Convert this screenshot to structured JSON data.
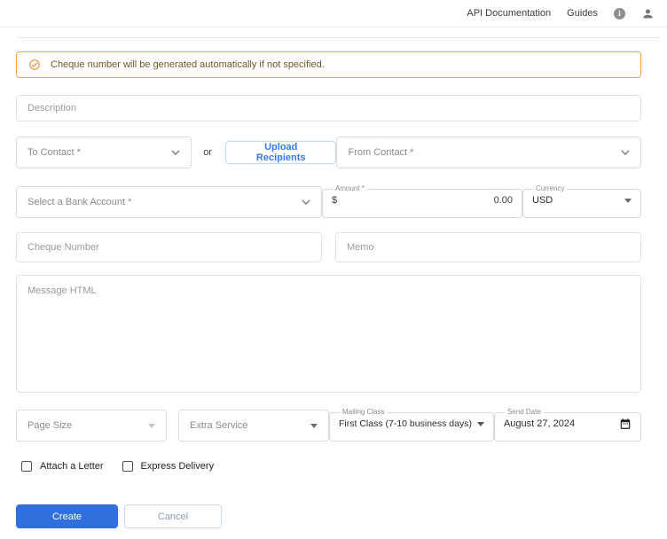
{
  "header": {
    "links": [
      {
        "label": "API Documentation"
      },
      {
        "label": "Guides"
      }
    ],
    "info_icon": "info-icon",
    "user_icon": "user-icon"
  },
  "banner": {
    "icon": "check-circle-icon",
    "text": "Cheque number will be generated automatically if not specified."
  },
  "form": {
    "description": {
      "placeholder": "Description"
    },
    "to_contact": {
      "label": "To Contact *"
    },
    "or_label": "or",
    "upload_recipients_label": "Upload Recipients",
    "from_contact": {
      "label": "From Contact *"
    },
    "bank_account": {
      "label": "Select a Bank Account *"
    },
    "amount": {
      "label": "Amount *",
      "prefix": "$",
      "value": "0.00"
    },
    "currency": {
      "label": "Currency",
      "value": "USD"
    },
    "cheque_number": {
      "placeholder": "Cheque Number"
    },
    "memo": {
      "placeholder": "Memo"
    },
    "message_html": {
      "placeholder": "Message HTML"
    },
    "page_size": {
      "label": "Page Size"
    },
    "extra_service": {
      "label": "Extra Service"
    },
    "mailing_class": {
      "label": "Mailing Class",
      "value": "First Class (7-10 business days)"
    },
    "send_date": {
      "label": "Send Date",
      "value": "August 27, 2024",
      "icon": "calendar-icon"
    },
    "checkboxes": [
      {
        "label": "Attach a Letter",
        "checked": false
      },
      {
        "label": "Express Delivery",
        "checked": false
      }
    ],
    "create_label": "Create",
    "cancel_label": "Cancel"
  },
  "colors": {
    "accent_blue": "#2f6fde",
    "link_blue": "#3b79e8",
    "banner_orange": "#f0a44c",
    "banner_icon_orange": "#e8923f",
    "banner_text": "#6f5724",
    "border_gray": "#dcdcdc",
    "placeholder_gray": "#8a8a8a"
  }
}
